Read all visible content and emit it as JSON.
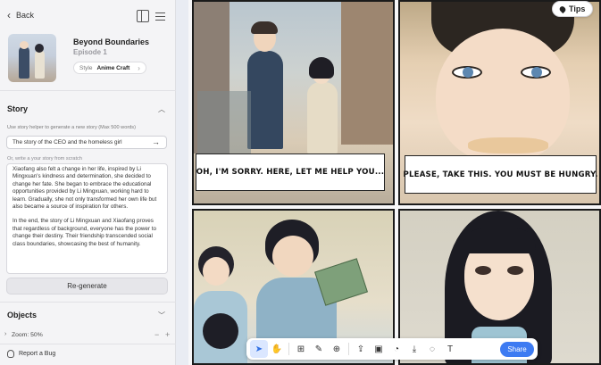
{
  "sidebar": {
    "back_label": "Back",
    "project": {
      "title": "Beyond Boundaries",
      "episode": "Episode 1",
      "style_label": "Style",
      "style_value": "Anime Craft"
    },
    "story": {
      "heading": "Story",
      "helper_text": "Use story helper to generate a new story (Max 500 words)",
      "prompt_value": "The story of the CEO and the homeless girl",
      "or_write": "Or, write a your story from scratch",
      "paragraphs": [
        "Xiaofang also felt a change in her life, inspired by Li Mingxuan's kindness and determination, she decided to change her fate. She began to embrace the educational opportunities provided by Li Mingxuan, working hard to learn. Gradually, she not only transformed her own life but also became a source of inspiration for others.",
        "In the end, the story of Li Mingxuan and Xiaofang proves that regardless of background, everyone has the power to change their destiny. Their friendship transcended social class boundaries, showcasing the best of humanity."
      ],
      "regenerate_label": "Re-generate"
    },
    "objects_heading": "Objects",
    "zoom_label": "Zoom: 50%",
    "report_bug_label": "Report a Bug"
  },
  "canvas": {
    "tips_label": "Tips",
    "panels": [
      {
        "caption": "OH, I'M SORRY. HERE, LET ME HELP YOU..."
      },
      {
        "caption": "PLEASE, TAKE THIS. YOU MUST BE HUNGRY."
      },
      {
        "caption": ""
      },
      {
        "caption": ""
      }
    ]
  },
  "toolbar": {
    "tools": [
      "cursor-icon",
      "hand-icon",
      "add-frame-icon",
      "edit-image-icon",
      "add-page-icon",
      "upload-icon",
      "image-icon",
      "speech-bubble-icon",
      "download-icon",
      "comment-icon",
      "text-icon"
    ],
    "share_label": "Share"
  },
  "colors": {
    "accent": "#3d7bf2",
    "sidebar_bg": "#f4f4f6",
    "panel_border": "#1b1b1b"
  }
}
